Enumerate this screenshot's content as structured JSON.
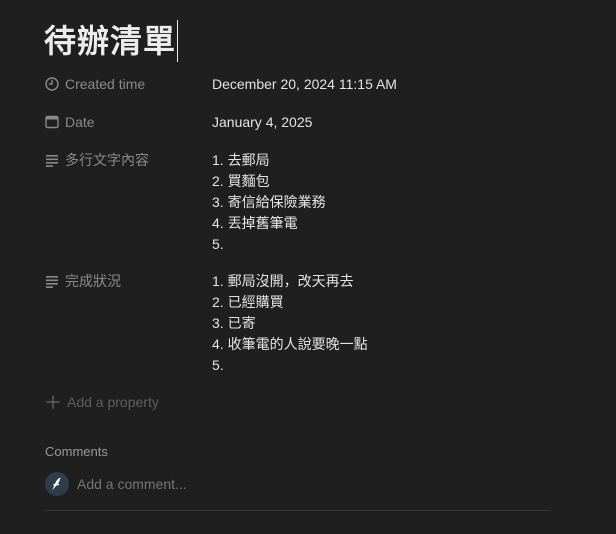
{
  "page": {
    "title": "待辦清單"
  },
  "properties": [
    {
      "icon": "clock-icon",
      "label": "Created time",
      "value": "December 20, 2024 11:15 AM"
    },
    {
      "icon": "calendar-icon",
      "label": "Date",
      "value": "January 4, 2025"
    },
    {
      "icon": "text-lines-icon",
      "label": "多行文字內容",
      "lines": [
        "1. 去郵局",
        "2. 買麵包",
        "3. 寄信給保險業務",
        "4. 丟掉舊筆電",
        "5."
      ]
    },
    {
      "icon": "text-lines-icon",
      "label": "完成狀況",
      "lines": [
        "1. 郵局沒開，改天再去",
        "2. 已經購買",
        "3. 已寄",
        "4. 收筆電的人說要晚一點",
        "5."
      ]
    }
  ],
  "add_property": {
    "label": "Add a property"
  },
  "comments": {
    "header": "Comments",
    "placeholder": "Add a comment..."
  }
}
